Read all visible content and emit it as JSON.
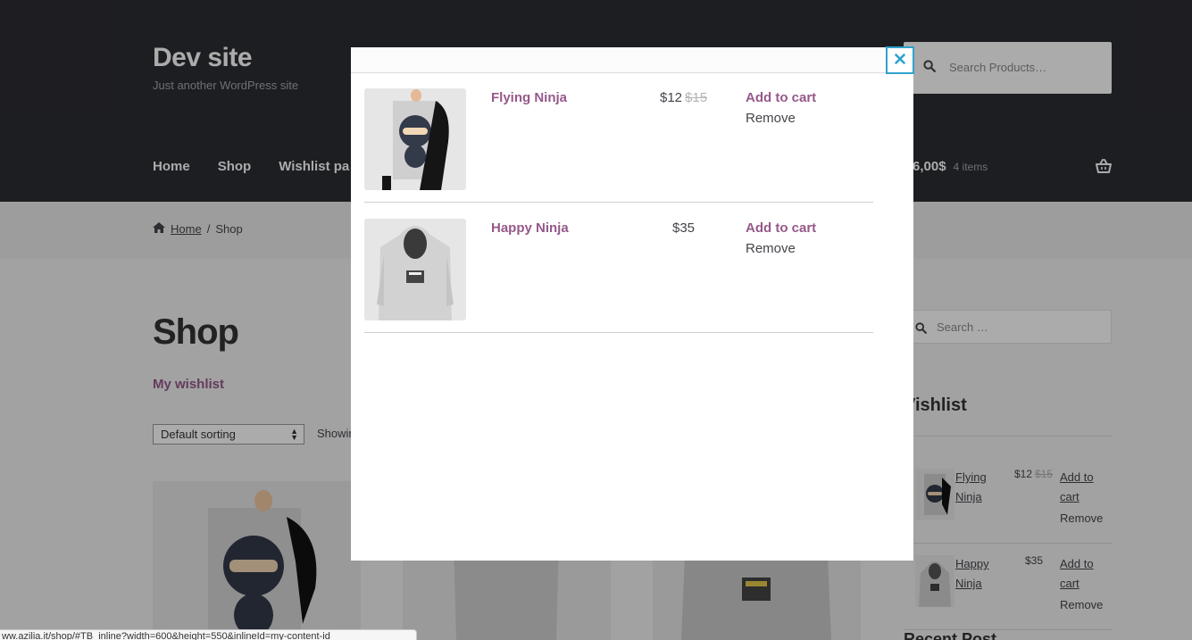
{
  "site": {
    "title": "Dev site",
    "description": "Just another WordPress site",
    "search_placeholder": "Search Products…"
  },
  "nav": {
    "items": [
      "Home",
      "Shop",
      "Wishlist pa"
    ],
    "cart_total": "6,00$",
    "cart_count": "4 items"
  },
  "breadcrumb": {
    "home": "Home",
    "separator": "/",
    "current": "Shop"
  },
  "page": {
    "heading": "Shop",
    "wishlist_link": "My wishlist",
    "sorting_selected": "Default sorting",
    "showing_text": "Showin"
  },
  "sidebar": {
    "search_placeholder": "Search …",
    "widget_title": "Vishlist",
    "items": [
      {
        "name": "Flying Ninja",
        "price": "$12",
        "old_price": "$15",
        "add_label": "Add to cart",
        "remove_label": "Remove"
      },
      {
        "name": "Happy Ninja",
        "price": "$35",
        "old_price": "",
        "add_label": "Add to cart",
        "remove_label": "Remove"
      }
    ],
    "next_heading": "Recent Post"
  },
  "status_bar": {
    "url": "ww.azilia.it/shop/#TB_inline?width=600&height=550&inlineId=my-content-id"
  },
  "modal": {
    "close_label": "×",
    "items": [
      {
        "name": "Flying Ninja",
        "price": "$12",
        "old_price": "$15",
        "add_label": "Add to cart",
        "remove_label": "Remove"
      },
      {
        "name": "Happy Ninja",
        "price": "$35",
        "old_price": "",
        "add_label": "Add to cart",
        "remove_label": "Remove"
      }
    ]
  },
  "colors": {
    "header_bg": "#2c2d33",
    "accent": "#96588a",
    "close_border": "#2ea2cc"
  }
}
